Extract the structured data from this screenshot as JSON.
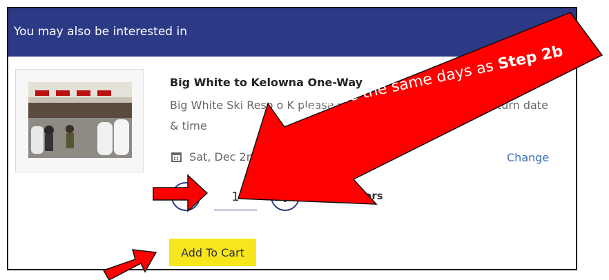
{
  "header": {
    "title": "You may also be interested in"
  },
  "product": {
    "title": "Big White to Kelowna One-Way",
    "description": "Big White Ski Reso o K please use Select A Time dr your Return date & time",
    "date": "Sat, Dec 2nd M - 3 Hours",
    "change_label": "Change",
    "image_icon": "airport-checkin-photo"
  },
  "quantity": {
    "value": "1",
    "label": "Passengers"
  },
  "cart": {
    "button_label": "Add To Cart"
  },
  "annotation": {
    "text": "Choose the same days as ",
    "step": "Step 2b"
  },
  "colors": {
    "header_bg": "#2c3a86",
    "button_bg": "#f7e61c",
    "arrow": "#ff0000",
    "link": "#3a6fb6"
  }
}
